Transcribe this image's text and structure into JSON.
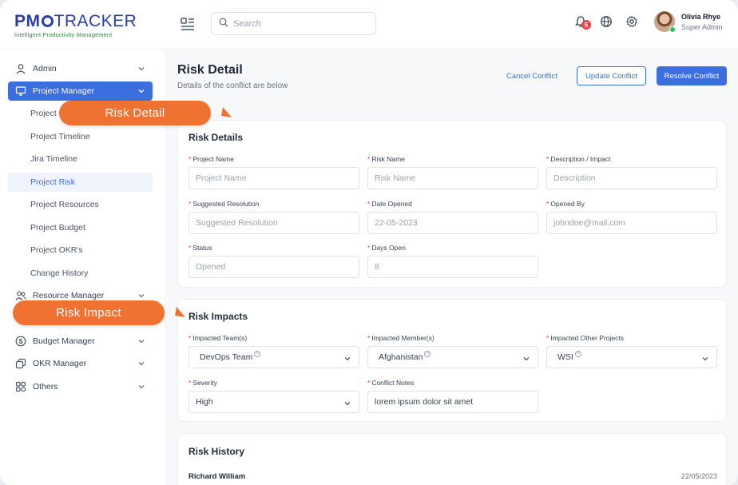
{
  "brand": {
    "logo_pm": "PM",
    "logo_tracker": "TRACKER",
    "tagline": "Intelligent Productivity Management"
  },
  "search": {
    "placeholder": "Search"
  },
  "notifications": {
    "count": "5"
  },
  "user": {
    "name": "Olivia Rhye",
    "role": "Super Admin"
  },
  "sidebar": {
    "admin": "Admin",
    "project_manager": "Project Manager",
    "sub_items": [
      "Project",
      "Project Timeline",
      "Jira Timeline",
      "Project Risk",
      "Project Resources",
      "Project Budget",
      "Project OKR's",
      "Change History"
    ],
    "resource_manager": "Resource Manager",
    "budget_manager": "Budget Manager",
    "okr_manager": "OKR Manager",
    "others": "Others"
  },
  "callouts": {
    "risk_detail": "Risk Detail",
    "risk_impact": "Risk Impact"
  },
  "page": {
    "title": "Risk Detail",
    "subtitle": "Details of the conflict are below",
    "cancel_label": "Cancel Conflict",
    "update_label": "Update Conflict",
    "resolve_label": "Resolve Conflict"
  },
  "risk_details": {
    "title": "Risk Details",
    "project_name": {
      "label": "Project Name",
      "placeholder": "Project Name"
    },
    "risk_name": {
      "label": "Risk Name",
      "placeholder": "Risk Name"
    },
    "description": {
      "label": "Description / Impact",
      "placeholder": "Description"
    },
    "suggested_resolution": {
      "label": "Suggested Resolution",
      "placeholder": "Suggested Resolution"
    },
    "date_opened": {
      "label": "Date Opened",
      "value": "22-05-2023"
    },
    "opened_by": {
      "label": "Opened By",
      "value": "johndoe@mail.com"
    },
    "status": {
      "label": "Status",
      "value": "Opened"
    },
    "days_open": {
      "label": "Days Open",
      "value": "8"
    }
  },
  "risk_impacts": {
    "title": "Risk Impacts",
    "teams": {
      "label": "Impacted Team(s)",
      "value": "DevOps Team"
    },
    "members": {
      "label": "Impacted Member(s)",
      "value": "Afghanistan"
    },
    "other_projects": {
      "label": "Impacted Other Projects",
      "value": "WSI"
    },
    "severity": {
      "label": "Severity",
      "value": "High"
    },
    "conflict_notes": {
      "label": "Conflict Notes",
      "value": "lorem ipsum dolor sit amet"
    }
  },
  "risk_history": {
    "title": "Risk History",
    "entries": [
      {
        "name": "Richard William",
        "date": "22/05/2023"
      }
    ]
  },
  "colors": {
    "accent": "#3b6fe0",
    "callout": "#f07230",
    "brand": "#2b3ea5",
    "tagline": "#3a8a4a",
    "required": "#ef4444"
  }
}
